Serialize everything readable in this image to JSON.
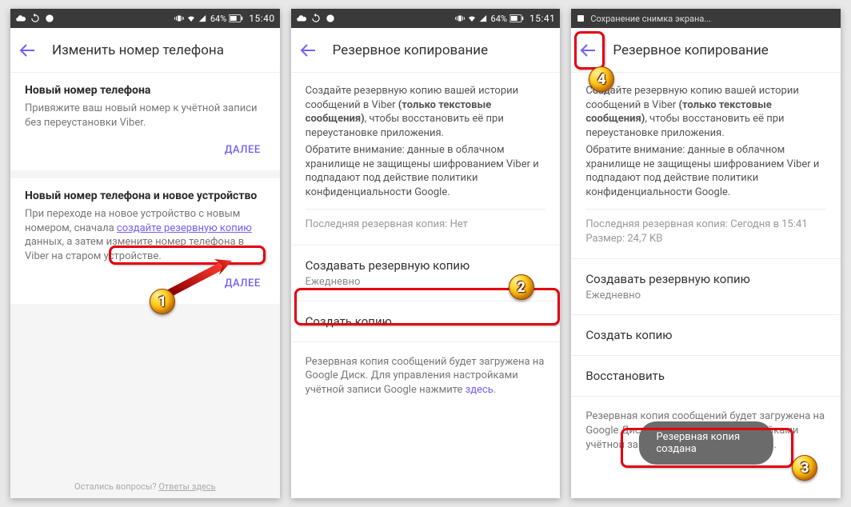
{
  "status": {
    "battery": "64%",
    "time1": "15:40",
    "time2": "15:41",
    "saving": "Сохранение снимка экрана..."
  },
  "screen1": {
    "title": "Изменить номер телефона",
    "s1title": "Новый номер телефона",
    "s1text": "Привяжите ваш новый номер к учётной записи без переустановки Viber.",
    "next": "ДАЛЕЕ",
    "s2title": "Новый номер телефона и новое устройство",
    "s2text_a": "При переходе на новое устройство с новым номером, сначала ",
    "s2link": "создайте резервную копию",
    "s2text_b": " данных, а затем измените номер телефона в Viber на старом устройстве.",
    "foot_a": "Остались вопросы? ",
    "foot_b": "Ответы здесь"
  },
  "screen2": {
    "title": "Резервное копирование",
    "desc_a": "Создайте резервную копию вашей истории сообщений в Viber ",
    "desc_bold": "(только текстовые сообщения)",
    "desc_b": ", чтобы восстановить её при переустановке приложения.",
    "warn": "Обратите внимание: данные в облачном хранилище не защищены шифрованием Viber и подпадают под действие политики конфиденциальности Google.",
    "last": "Последняя резервная копия: Нет",
    "freq_t": "Создавать резервную копию",
    "freq_v": "Ежедневно",
    "make": "Создать копию",
    "foot_a": "Резервная копия сообщений будет загружена на Google Диск. Для управления настройками учётной записи Google нажмите ",
    "foot_link": "здесь",
    "foot_b": "."
  },
  "screen3": {
    "title": "Резервное копирование",
    "last": "Последняя резервная копия: Сегодня в 15:41",
    "size": "Размер: 24,7 KB",
    "restore": "Восстановить",
    "toast": "Резервная копия создана"
  }
}
